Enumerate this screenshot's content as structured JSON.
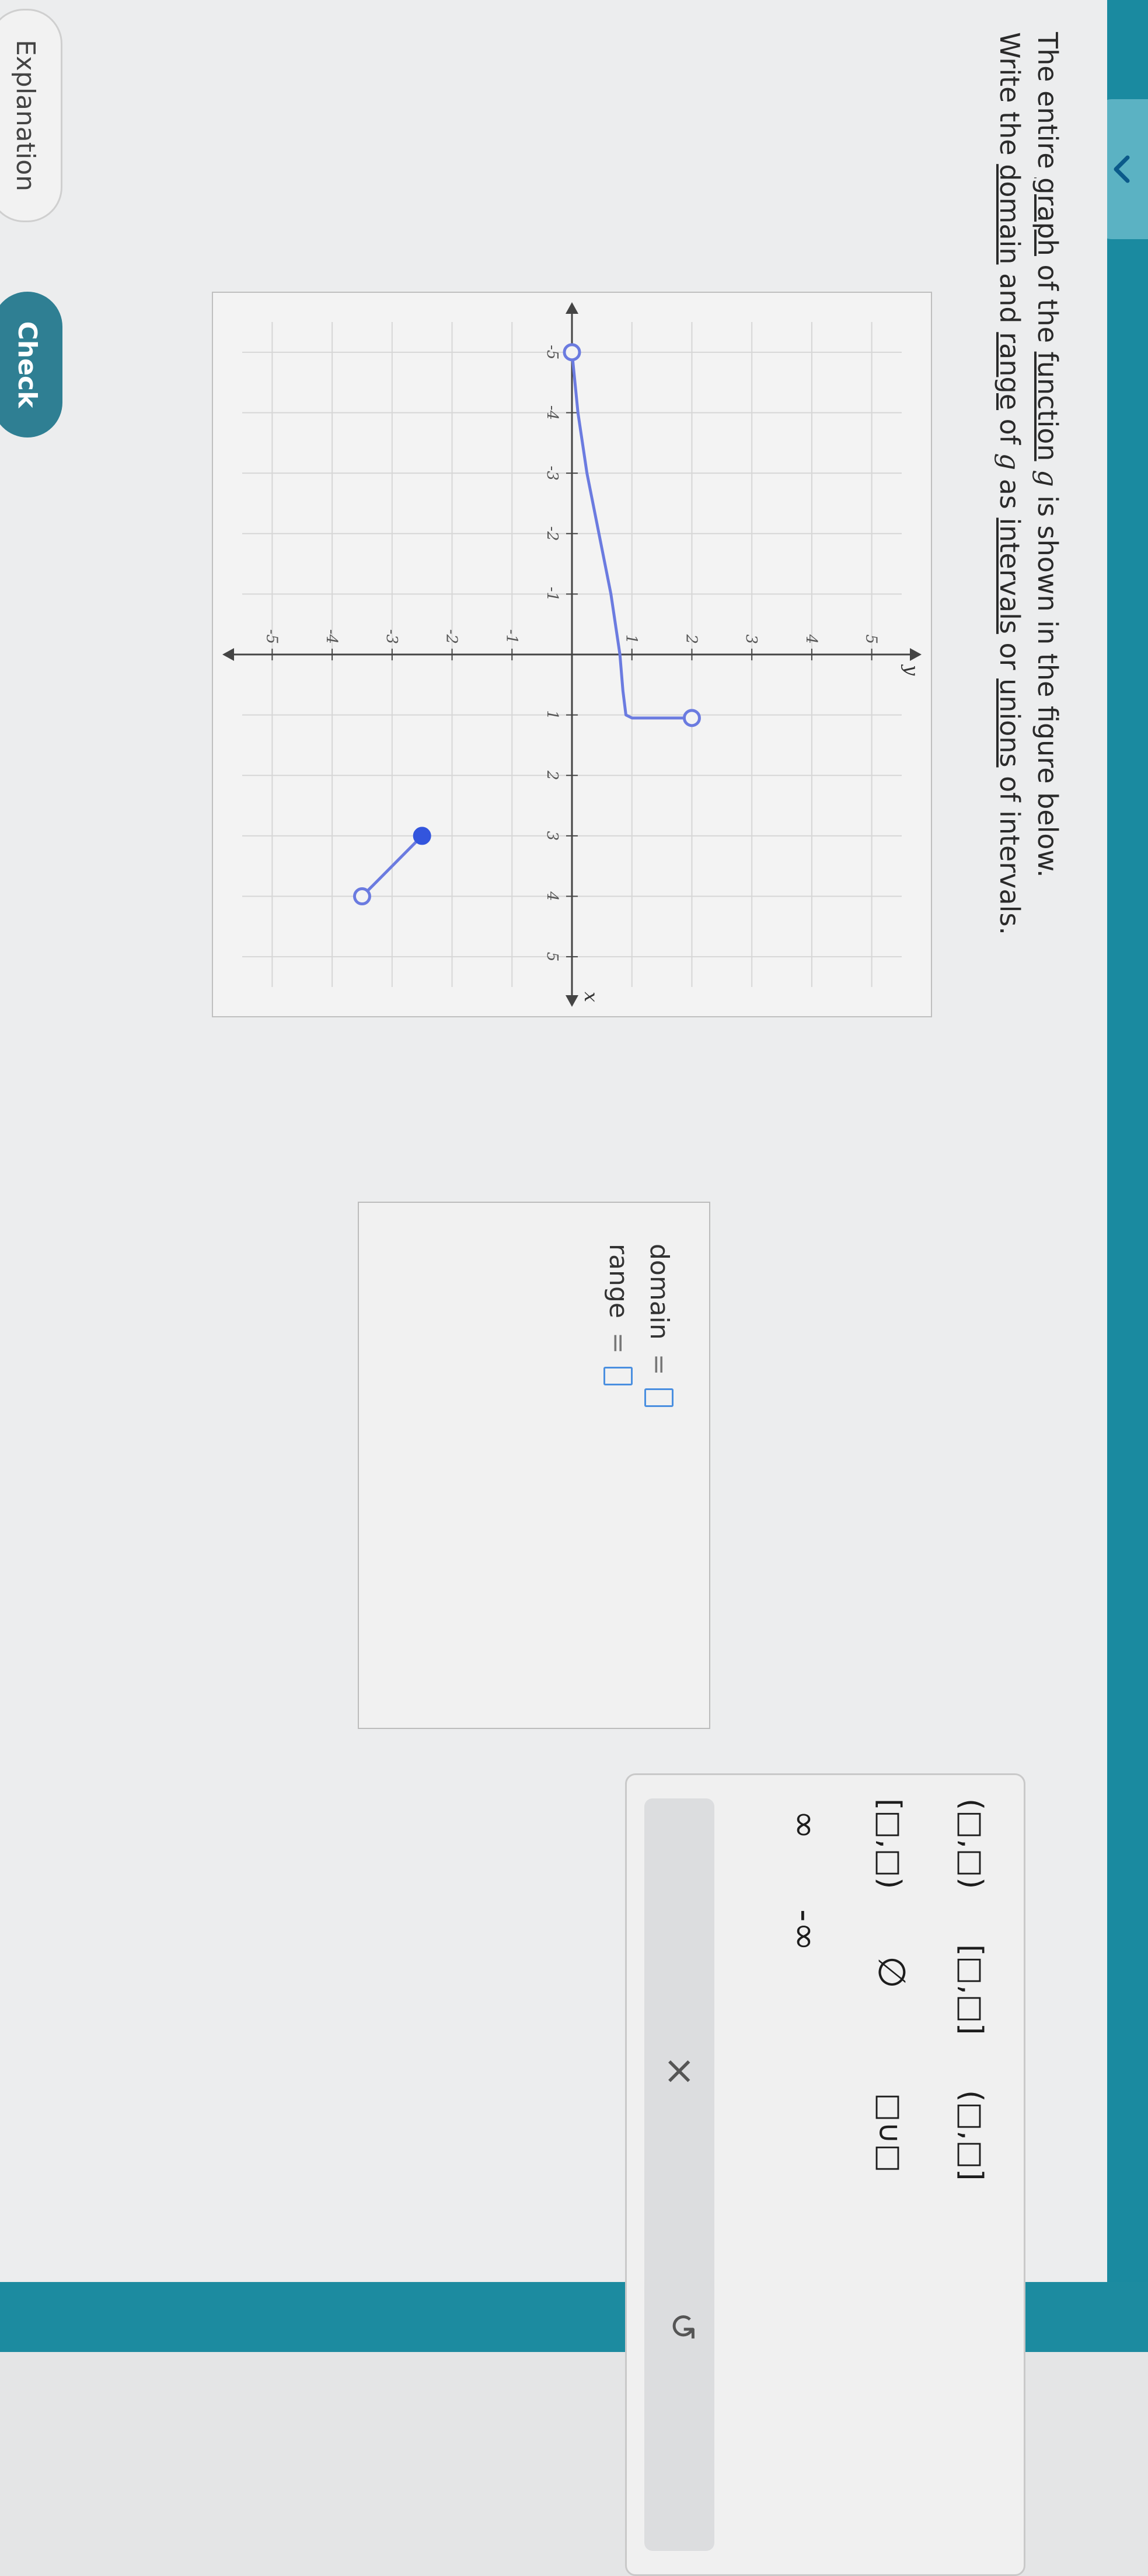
{
  "question": {
    "line1": {
      "a": "The entire ",
      "graph": "graph",
      "b": " of the ",
      "function": "function",
      "c": " ",
      "g": "g",
      "d": " is shown in the figure below."
    },
    "line2": {
      "a": "Write the ",
      "domain": "domain",
      "b": " and ",
      "range": "range",
      "c": " of ",
      "g": "g",
      "d": " as ",
      "intervals": "intervals",
      "e": " or ",
      "unions": "unions",
      "f": " of intervals."
    }
  },
  "chart_data": {
    "type": "line",
    "xlabel": "x",
    "ylabel": "y",
    "xlim": [
      -5.5,
      5.5
    ],
    "ylim": [
      -5.5,
      5.5
    ],
    "grid": true,
    "x_ticks": [
      "-5",
      "-4",
      "-3",
      "-2",
      "-1",
      "1",
      "2",
      "3",
      "4",
      "5"
    ],
    "y_ticks": [
      "5",
      "4",
      "3",
      "2",
      "1",
      "-1",
      "-2",
      "-3",
      "-4",
      "-5"
    ],
    "series": [
      {
        "points": [
          [
            -5,
            0
          ],
          [
            -4,
            0.1
          ],
          [
            -3,
            0.25
          ],
          [
            -2,
            0.45
          ],
          [
            -1,
            0.65
          ],
          [
            0,
            0.8
          ],
          [
            0.6,
            0.85
          ],
          [
            1,
            0.9
          ],
          [
            1.05,
            1
          ],
          [
            1.05,
            2
          ]
        ],
        "start": "open",
        "end": "open"
      },
      {
        "points": [
          [
            3,
            -2.5
          ],
          [
            3.3,
            -2.8
          ],
          [
            3.6,
            -3.1
          ],
          [
            4,
            -3.5
          ]
        ],
        "start": "closed",
        "end": "open"
      }
    ],
    "color": "#6b7be0"
  },
  "answer": {
    "domain_label": "domain",
    "range_label": "range",
    "equals": "="
  },
  "palette": {
    "open_open": "(□,□)",
    "closed_closed": "[□,□]",
    "open_closed": "(□,□]",
    "closed_open": "[□,□)",
    "empty_set": "∅",
    "union": "□∪□",
    "infinity": "∞",
    "neg_infinity": "-∞",
    "clear": "×",
    "undo": "↺"
  },
  "buttons": {
    "check": "Check",
    "explanation": "Explanation"
  }
}
